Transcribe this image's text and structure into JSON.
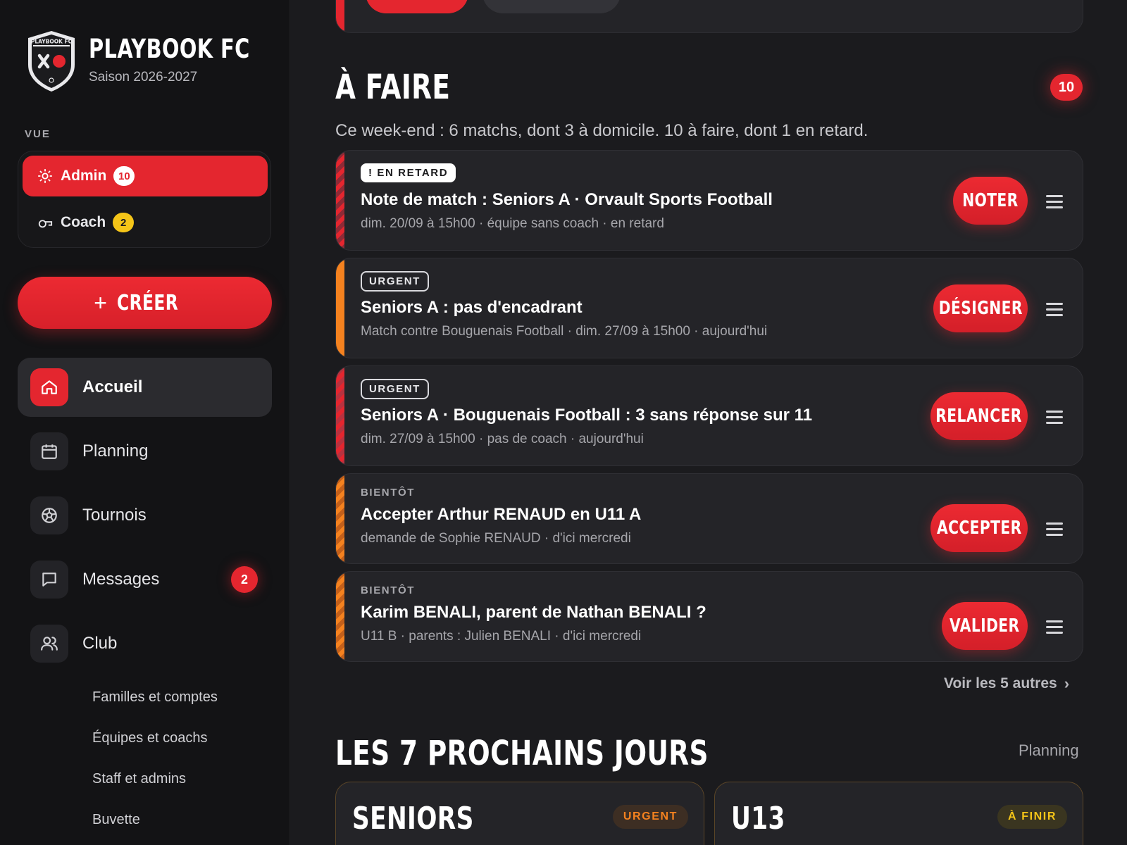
{
  "brand": {
    "name": "PLAYBOOK FC",
    "season": "Saison 2026-2027",
    "crest_text": "PLAYBOOK FC"
  },
  "sidebar": {
    "view_label": "VUE",
    "roles": [
      {
        "label": "Admin",
        "badge": "10",
        "icon": "sun-icon",
        "active": true
      },
      {
        "label": "Coach",
        "badge": "2",
        "icon": "whistle-icon",
        "active": false
      }
    ],
    "create_label": "CRÉER",
    "nav": [
      {
        "label": "Accueil",
        "icon": "home-icon",
        "active": true
      },
      {
        "label": "Planning",
        "icon": "calendar-icon"
      },
      {
        "label": "Tournois",
        "icon": "ball-icon"
      },
      {
        "label": "Messages",
        "icon": "message-icon",
        "badge": "2"
      },
      {
        "label": "Club",
        "icon": "users-icon"
      }
    ],
    "club_sub": [
      "Familles et comptes",
      "Équipes et coachs",
      "Staff et admins",
      "Buvette"
    ]
  },
  "todo": {
    "title": "À FAIRE",
    "count": "10",
    "summary": "Ce week-end : 6 matchs, dont 3 à domicile. 10 à faire, dont 1 en retard.",
    "tasks": [
      {
        "tag": "! EN RETARD",
        "title": "Note de match : Seniors A · Orvault Sports Football",
        "meta": "dim. 20/09 à 15h00 · équipe sans coach · en retard",
        "action": "NOTER"
      },
      {
        "tag": "URGENT",
        "title": "Seniors A : pas d'encadrant",
        "meta": "Match contre Bouguenais Football · dim. 27/09 à 15h00 · aujourd'hui",
        "action": "DÉSIGNER"
      },
      {
        "tag": "URGENT",
        "title": "Seniors A · Bouguenais Football : 3 sans réponse sur 11",
        "meta": "dim. 27/09 à 15h00 · pas de coach · aujourd'hui",
        "action": "RELANCER"
      },
      {
        "tag": "BIENTÔT",
        "title": "Accepter Arthur RENAUD en U11 A",
        "meta": "demande de Sophie RENAUD · d'ici mercredi",
        "action": "ACCEPTER"
      },
      {
        "tag": "BIENTÔT",
        "title": "Karim BENALI, parent de Nathan BENALI ?",
        "meta": "U11 B · parents : Julien BENALI · d'ici mercredi",
        "action": "VALIDER"
      }
    ],
    "see_more": "Voir les 5 autres"
  },
  "next_days": {
    "title": "LES 7 PROCHAINS JOURS",
    "link": "Planning",
    "teams": [
      {
        "name": "SENIORS",
        "tag": "URGENT"
      },
      {
        "name": "U13",
        "tag": "À FINIR"
      }
    ]
  },
  "colors": {
    "accent": "#e4262f",
    "orange": "#f5821f",
    "yellow": "#f5c518",
    "bg": "#1b1b1e",
    "sidebar": "#131315",
    "card": "#242428"
  }
}
